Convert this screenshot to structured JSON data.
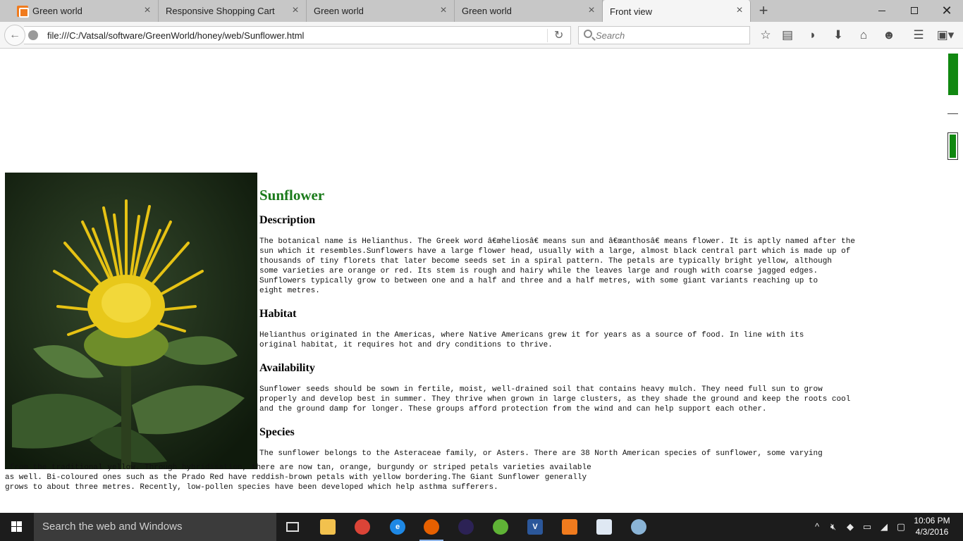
{
  "browser": {
    "tabs": [
      {
        "title": "Green world",
        "active": false
      },
      {
        "title": "Responsive Shopping Cart",
        "active": false
      },
      {
        "title": "Green world",
        "active": false
      },
      {
        "title": "Green world",
        "active": false
      },
      {
        "title": "Front view",
        "active": true
      }
    ],
    "url": "file:///C:/Vatsal/software/GreenWorld/honey/web/Sunflower.html",
    "search_placeholder": "Search"
  },
  "page": {
    "title": "Sunflower",
    "sections": [
      {
        "heading": "Description",
        "text": "The botanical name is Helianthus. The Greek word â€œheliosâ€ means sun and â€œanthosâ€ means flower. It is aptly named after the\nsun which it resembles.Sunflowers have a large flower head, usually with a large, almost black central part which is made up of\nthousands of tiny florets that later become seeds set in a spiral pattern. The petals are typically bright yellow, although\nsome varieties are orange or red. Its stem is rough and hairy while the leaves large and rough with coarse jagged edges.\nSunflowers typically grow to between one and a half and three and a half metres, with some giant variants reaching up to\neight metres."
      },
      {
        "heading": "Habitat",
        "text": "Helianthus originated in the Americas, where Native Americans grew it for years as a source of food. In line with its\noriginal habitat, it requires hot and dry conditions to thrive."
      },
      {
        "heading": "Availability",
        "text": "Sunflower seeds should be sown in fertile, moist, well-drained soil that contains heavy mulch. They need full sun to grow\nproperly and develop best in summer. They thrive when grown in large clusters, as they shade the ground and keep the roots cool\nand the ground damp for longer. These groups afford protection from the wind and can help support each other."
      },
      {
        "heading": "Species",
        "text": "The sunflower belongs to the Asteraceae family, or Asters. There are 38 North American species of sunflower, some varying"
      }
    ],
    "species_wrap": " from the traditional yellow. Through hybridisation, there are now tan, orange, burgundy or striped petals varieties available\nas well. Bi-coloured ones such as the Prado Red have reddish-brown petals with yellow bordering.The Giant Sunflower generally\ngrows to about three metres. Recently, low-pollen species have been developed which help asthma sufferers."
  },
  "taskbar": {
    "search_text": "Search the web and Windows",
    "time": "10:06 PM",
    "date": "4/3/2016"
  }
}
